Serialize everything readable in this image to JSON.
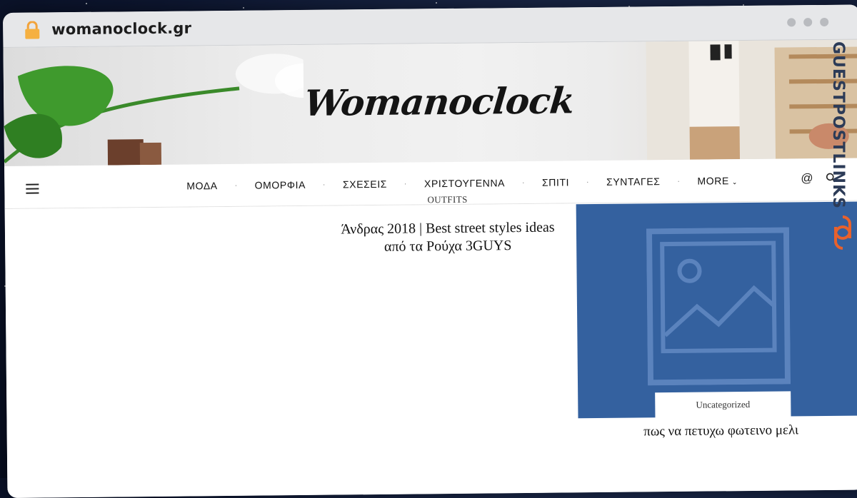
{
  "browser": {
    "url": "womanoclock.gr"
  },
  "site": {
    "logo_text": "Womanoclock"
  },
  "nav": {
    "items": [
      {
        "label": "ΜΟΔΑ"
      },
      {
        "label": "ΟΜΟΡΦΙΑ"
      },
      {
        "label": "ΣΧΕΣΕΙΣ"
      },
      {
        "label": "ΧΡΙΣΤΟΥΓΕΝΝΑ"
      },
      {
        "label": "ΣΠΙΤΙ"
      },
      {
        "label": "ΣΥΝΤΑΓΕΣ"
      }
    ],
    "more_label": "MORE",
    "at_symbol": "@"
  },
  "posts": [
    {
      "category": "OUTFITS",
      "title_line1": "Άνδρας 2018 | Best street styles ideas",
      "title_line2": "από τα Ρούχα 3GUYS"
    },
    {
      "category": "Uncategorized",
      "title": "πως να πετυχω φωτεινο μελι"
    }
  ],
  "watermark": {
    "text": "GUESTPOSTLINKS"
  },
  "colors": {
    "card_bg": "#34619f",
    "watermark_orange": "#e8612c",
    "watermark_navy": "#2c3b57"
  }
}
